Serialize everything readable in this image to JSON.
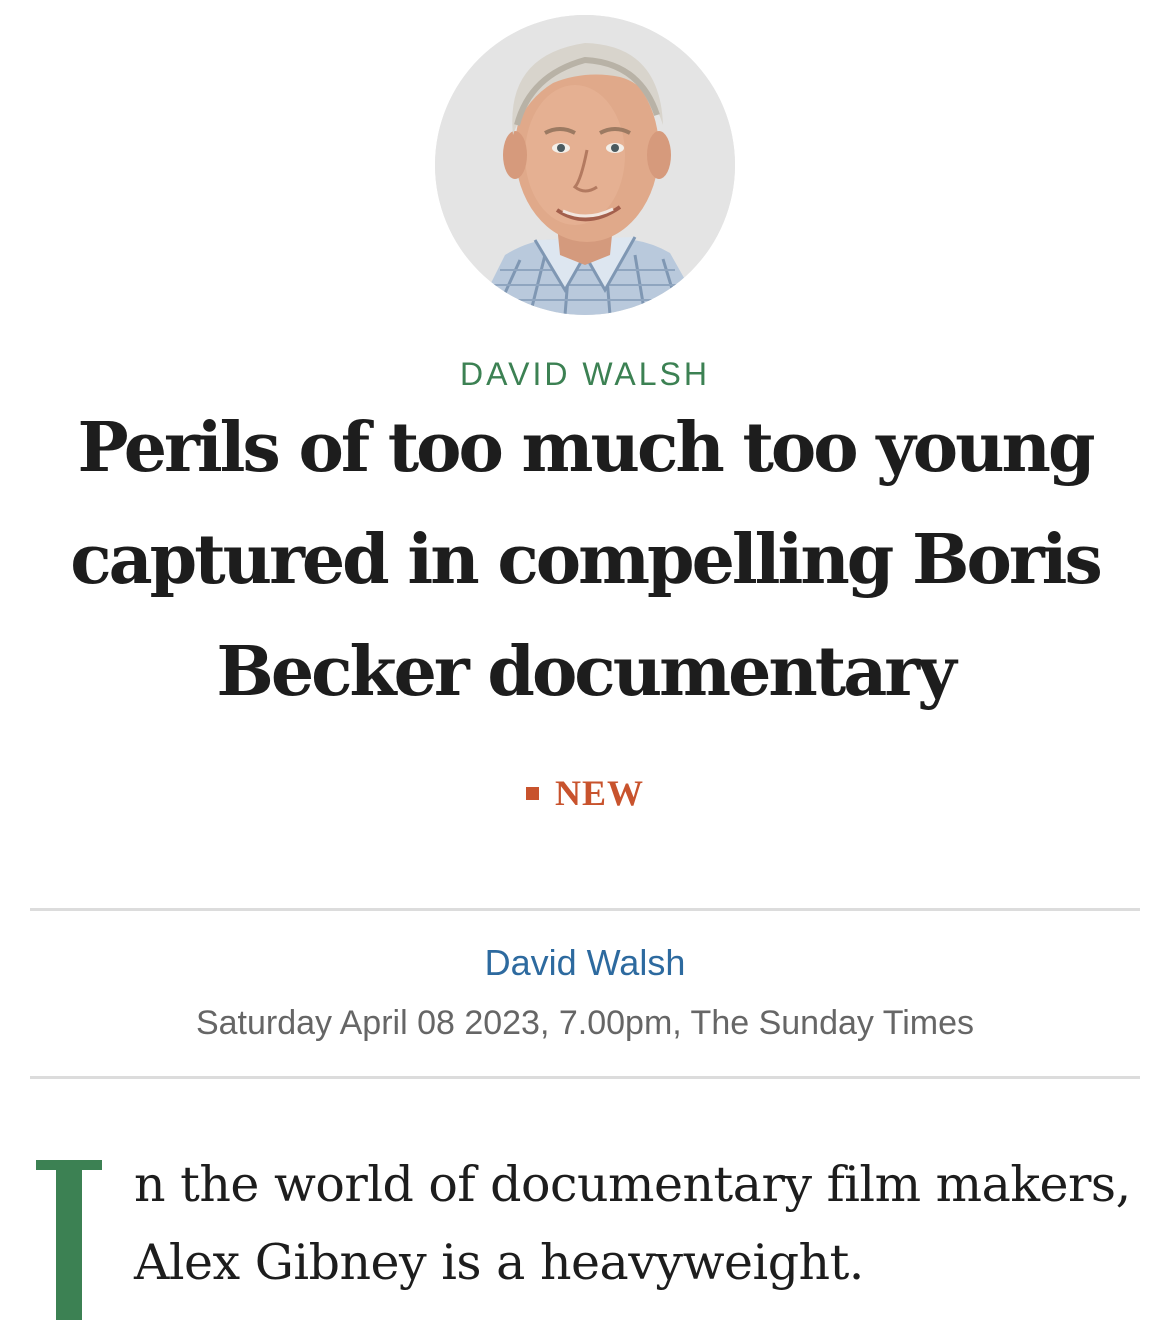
{
  "author_photo": {
    "alt": "David Walsh"
  },
  "article": {
    "kicker": "DAVID WALSH",
    "headline": "Perils of too much too young captured in compelling Boris Becker documentary",
    "badge": "NEW",
    "byline_author": "David Walsh",
    "byline_meta": "Saturday April 08 2023, 7.00pm, The Sunday Times",
    "dropcap": "I",
    "body_first": "n the world of documentary film makers, Alex Gibney is a heavyweight."
  },
  "colors": {
    "kicker_green": "#3c8153",
    "badge_orange": "#c8532d",
    "byline_blue": "#2d6a9f",
    "meta_gray": "#666666",
    "text": "#1d1d1d",
    "rule": "#dcdcdc"
  }
}
